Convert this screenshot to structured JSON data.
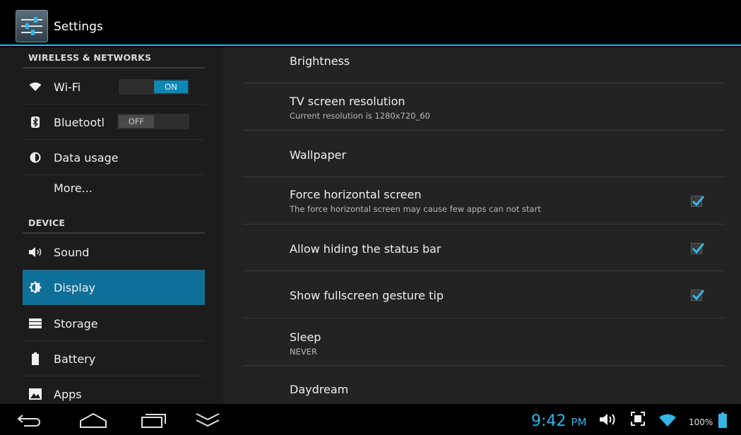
{
  "action_bar": {
    "title": "Settings",
    "icon": "settings-sliders-icon",
    "accent": "#33b5e5"
  },
  "sidebar": {
    "sections": [
      {
        "header": "WIRELESS & NETWORKS"
      },
      {
        "header": "DEVICE"
      }
    ],
    "items": [
      {
        "label": "Wi-Fi",
        "icon": "wifi-icon",
        "toggle": "ON"
      },
      {
        "label": "Bluetootl",
        "icon": "bluetooth-icon",
        "toggle": "OFF"
      },
      {
        "label": "Data usage",
        "icon": "data-usage-icon"
      },
      {
        "label": "More...",
        "icon": ""
      },
      {
        "label": "Sound",
        "icon": "sound-icon"
      },
      {
        "label": "Display",
        "icon": "display-icon",
        "selected": true
      },
      {
        "label": "Storage",
        "icon": "storage-icon"
      },
      {
        "label": "Battery",
        "icon": "battery-icon"
      },
      {
        "label": "Apps",
        "icon": "apps-icon"
      }
    ],
    "selected_color": "#0f6f98"
  },
  "display_prefs": [
    {
      "title": "Brightness"
    },
    {
      "title": "TV screen resolution",
      "summary": "Current resolution is 1280x720_60"
    },
    {
      "title": "Wallpaper"
    },
    {
      "title": "Force horizontal screen",
      "summary": "The force horizontal screen may cause few apps can not start",
      "checked": true
    },
    {
      "title": "Allow hiding the status bar",
      "checked": true
    },
    {
      "title": "Show fullscreen gesture tip",
      "checked": true
    },
    {
      "title": "Sleep",
      "summary": "NEVER"
    },
    {
      "title": "Daydream"
    }
  ],
  "system_bar": {
    "buttons": [
      "back-icon",
      "home-icon",
      "recent-apps-icon",
      "hide-bar-icon"
    ],
    "time": "9:42",
    "ampm": "PM",
    "battery": "100%",
    "status_icons": [
      "volume-icon",
      "screenshot-icon",
      "wifi-signal-icon",
      "battery-icon"
    ]
  }
}
